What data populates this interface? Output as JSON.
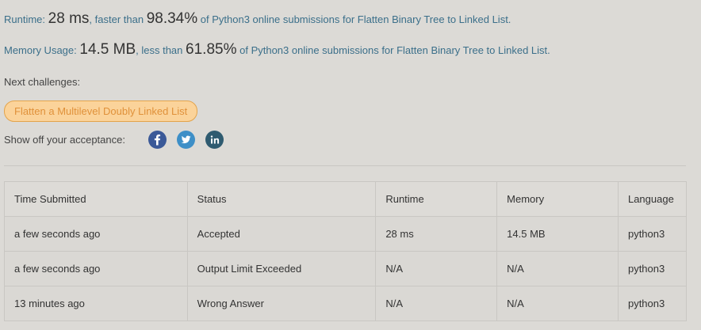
{
  "runtime": {
    "label": "Runtime:",
    "value": "28 ms",
    "mid": ", faster than",
    "percent": "98.34%",
    "suffix": "of Python3 online submissions for Flatten Binary Tree to Linked List."
  },
  "memory": {
    "label": "Memory Usage:",
    "value": "14.5 MB",
    "mid": ", less than",
    "percent": "61.85%",
    "suffix": "of Python3 online submissions for Flatten Binary Tree to Linked List."
  },
  "next_challenges": {
    "label": "Next challenges:",
    "items": [
      "Flatten a Multilevel Doubly Linked List"
    ]
  },
  "share": {
    "label": "Show off your acceptance:",
    "icons": [
      "facebook-icon",
      "twitter-icon",
      "linkedin-icon"
    ]
  },
  "table": {
    "headers": [
      "Time Submitted",
      "Status",
      "Runtime",
      "Memory",
      "Language"
    ],
    "rows": [
      [
        "a few seconds ago",
        "Accepted",
        "28 ms",
        "14.5 MB",
        "python3"
      ],
      [
        "a few seconds ago",
        "Output Limit Exceeded",
        "N/A",
        "N/A",
        "python3"
      ],
      [
        "13 minutes ago",
        "Wrong Answer",
        "N/A",
        "N/A",
        "python3"
      ]
    ]
  },
  "colors": {
    "accepted": "#3a7d6e",
    "error": "#b94747",
    "link_text": "#3b6f8a",
    "challenge_bg": "#fbd39a"
  }
}
